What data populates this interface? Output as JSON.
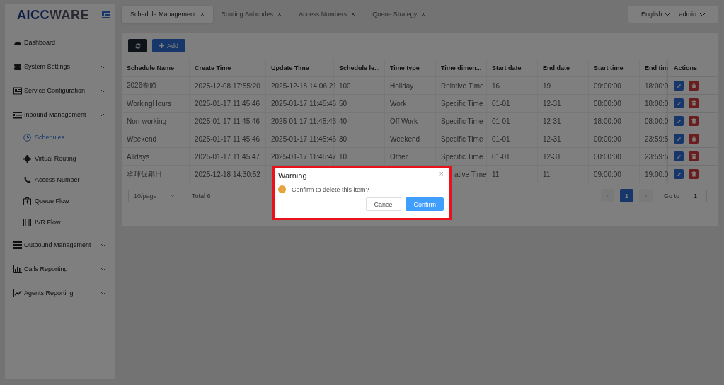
{
  "logo": {
    "dark": "AICC",
    "light": "WARE"
  },
  "sidebar": {
    "items": [
      {
        "label": "Dashboard"
      },
      {
        "label": "System Settings",
        "expanded": false
      },
      {
        "label": "Service Configuration",
        "expanded": false
      },
      {
        "label": "Inbound Management",
        "expanded": true,
        "children": [
          {
            "label": "Schedules",
            "selected": true
          },
          {
            "label": "Virtual Routing",
            "selected": false
          },
          {
            "label": "Access Number",
            "selected": false
          },
          {
            "label": "Queue Flow",
            "selected": false
          },
          {
            "label": "IVR Flow",
            "selected": false
          }
        ]
      },
      {
        "label": "Outbound Management",
        "expanded": false
      },
      {
        "label": "Calls Reporting",
        "expanded": false
      },
      {
        "label": "Agents Reporting",
        "expanded": false
      }
    ]
  },
  "tabs": [
    {
      "label": "Schedule Management",
      "selected": true
    },
    {
      "label": "Routing Subcodes",
      "selected": false
    },
    {
      "label": "Access Numbers",
      "selected": false
    },
    {
      "label": "Queue Strategy",
      "selected": false
    }
  ],
  "header": {
    "language": "English",
    "user": "admin"
  },
  "toolbar": {
    "add": "Add"
  },
  "table": {
    "columns": [
      "Schedule Name",
      "Create Time",
      "Update Time",
      "Schedule le...",
      "Time type",
      "Time dimen...",
      "Start date",
      "End date",
      "Start time",
      "End tim",
      "Actions"
    ],
    "rows": [
      [
        "2026春節",
        "2025-12-08 17:55:20",
        "2025-12-18 14:06:21",
        "100",
        "Holiday",
        "Relative Time",
        "16",
        "19",
        "09:00:00",
        "18:00:0"
      ],
      [
        "WorkingHours",
        "2025-01-17 11:45:46",
        "2025-01-17 11:45:46",
        "50",
        "Work",
        "Specific Time",
        "01-01",
        "12-31",
        "08:00:00",
        "18:00:0"
      ],
      [
        "Non-working",
        "2025-01-17 11:45:46",
        "2025-01-17 11:45:46",
        "40",
        "Off Work",
        "Specific Time",
        "01-01",
        "12-31",
        "18:00:00",
        "08:00:0"
      ],
      [
        "Weekend",
        "2025-01-17 11:45:46",
        "2025-01-17 11:45:46",
        "30",
        "Weekend",
        "Specific Time",
        "01-01",
        "12-31",
        "00:00:00",
        "23:59:5"
      ],
      [
        "Alldays",
        "2025-01-17 11:45:47",
        "2025-01-17 11:45:47",
        "10",
        "Other",
        "Specific Time",
        "01-01",
        "12-31",
        "00:00:00",
        "23:59:5"
      ],
      [
        "承暉促銷日",
        "2025-12-18 14:30:52",
        null,
        null,
        null,
        "ative Time",
        "11",
        "11",
        "09:00:00",
        "19:00:0"
      ]
    ]
  },
  "pagination": {
    "page_size": "10/page",
    "total": "Total 6",
    "prev": "‹",
    "page": "1",
    "next": "›",
    "goto_label": "Go to",
    "goto_value": "1"
  },
  "dialog": {
    "title": "Warning",
    "icon": "!",
    "message": "Confirm to delete this item?",
    "close": "×",
    "buttons": [
      "Cancel",
      "Confirm"
    ]
  }
}
